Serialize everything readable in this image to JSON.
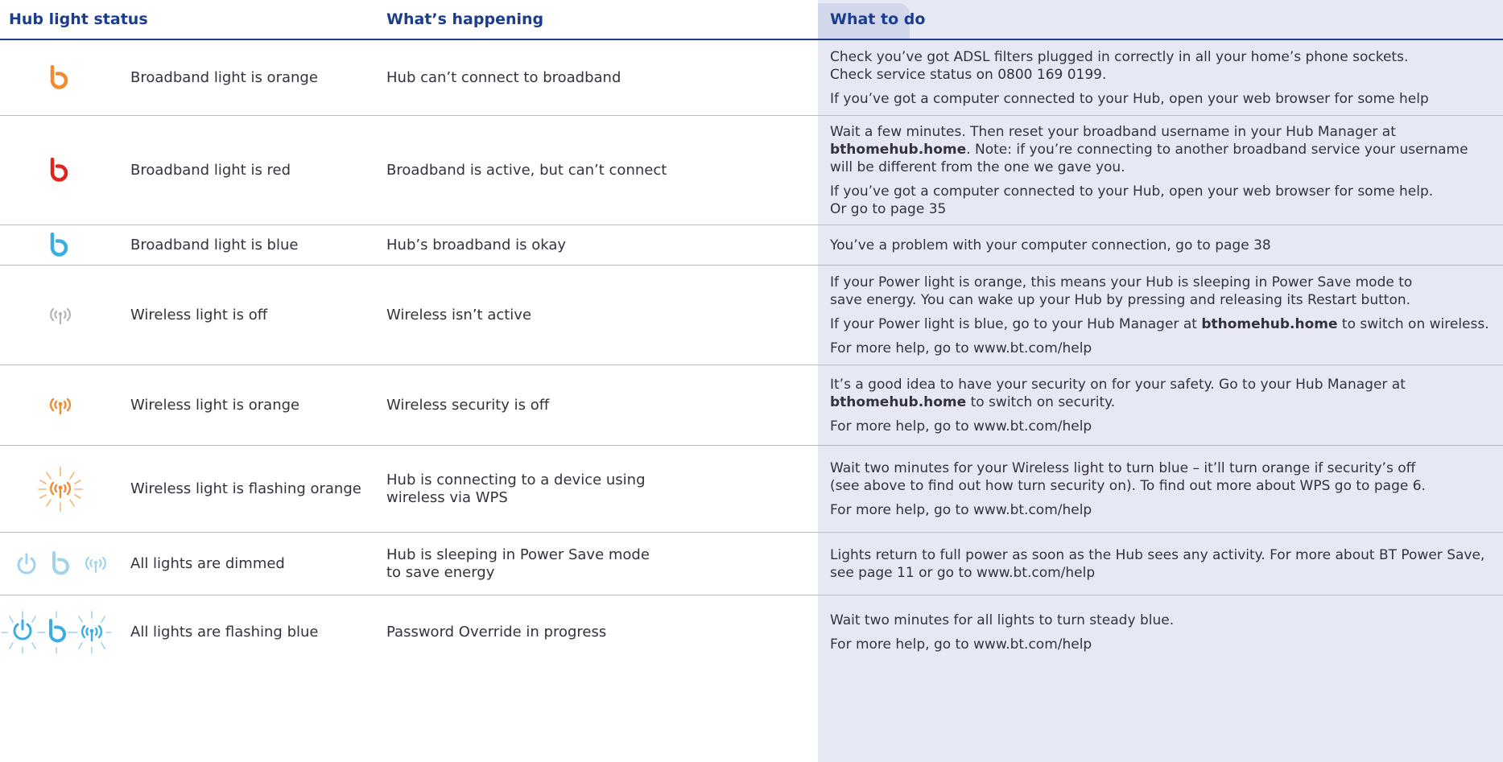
{
  "header": {
    "col1": "Hub light status",
    "col2": "What’s happening",
    "col3": "What to do"
  },
  "colors": {
    "header_blue": "#1a3d8f",
    "todo_background": "#e6e9f4",
    "orange": "#f28a2e",
    "red": "#e2231a",
    "blue": "#3aaee3",
    "grey": "#b4b4b4",
    "dim_blue": "#9fd3ee"
  },
  "rows": [
    {
      "icon": "broadband-icon-orange",
      "status": "Broadband light is orange",
      "happening": "Hub can’t connect to broadband",
      "todo": [
        [
          "Check you’ve got ADSL filters plugged in correctly in all your home’s phone sockets.",
          "Check service status on 0800 169 0199."
        ],
        [
          "If you’ve got a computer connected to your Hub, open your web browser for some help"
        ]
      ]
    },
    {
      "icon": "broadband-icon-red",
      "status": "Broadband light is red",
      "happening": "Broadband is active, but can’t connect",
      "todo_a": {
        "l1": "Wait a few minutes. Then reset your broadband username in your Hub Manager at",
        "bold": "bthomehub.home",
        "l2_rest": ". Note: if you’re connecting to another broadband service your username",
        "l3": "will be different from the one we gave you."
      },
      "todo_b": {
        "l1": "If you’ve got a computer connected to your Hub, open your web browser for some help.",
        "l2": "Or go to page 35"
      }
    },
    {
      "icon": "broadband-icon-blue",
      "status": "Broadband light is blue",
      "happening": "Hub’s broadband is okay",
      "todo": "You’ve a problem with your computer connection, go to page 38"
    },
    {
      "icon": "wireless-icon-grey",
      "status": "Wireless light is off",
      "happening": "Wireless isn’t active",
      "todo_a": {
        "l1": "If your Power light is orange, this means your Hub is sleeping in Power Save mode to",
        "l2_pre": "save energy. You can wake up your Hub by pressing and releasing its ",
        "l2_key": "Restart",
        "l2_post": " button."
      },
      "todo_b": {
        "pre": "If your Power light is blue, go to your Hub Manager at ",
        "bold": "bthomehub.home",
        "post": " to switch on wireless."
      },
      "todo_c": "For more help, go to www.bt.com/help"
    },
    {
      "icon": "wireless-icon-orange",
      "status": "Wireless light is orange",
      "happening": "Wireless security is off",
      "todo_a": {
        "l1": "It’s a good idea to have your security on for your safety. Go to your Hub Manager at",
        "bold": "bthomehub.home",
        "l2_rest": " to switch on security."
      },
      "todo_c": "For more help, go to www.bt.com/help"
    },
    {
      "icon": "wireless-flashing-icon-orange",
      "status": "Wireless light is flashing orange",
      "happening_l1": "Hub is connecting to a device using",
      "happening_l2": "wireless via WPS",
      "todo_a": {
        "l1": "Wait two minutes for your Wireless light to turn blue – it’ll turn orange if security’s off",
        "l2": "(see above to find out how turn security on). To find out more about WPS go to page 6."
      },
      "todo_c": "For more help, go to www.bt.com/help"
    },
    {
      "icon": "all-lights-dimmed-icons",
      "status": "All lights are dimmed",
      "happening_l1": "Hub is sleeping in Power Save mode",
      "happening_l2": "to save energy",
      "todo_a": {
        "l1": "Lights return to full power as soon as the Hub sees any activity. For more about BT Power Save,",
        "l2": "see page 11 or go to www.bt.com/help"
      }
    },
    {
      "icon": "all-lights-flashing-blue-icons",
      "status": "All lights are flashing blue",
      "happening": "Password Override in progress",
      "todo_a": "Wait two minutes for all lights to turn steady blue.",
      "todo_c": "For more help, go to www.bt.com/help"
    }
  ]
}
